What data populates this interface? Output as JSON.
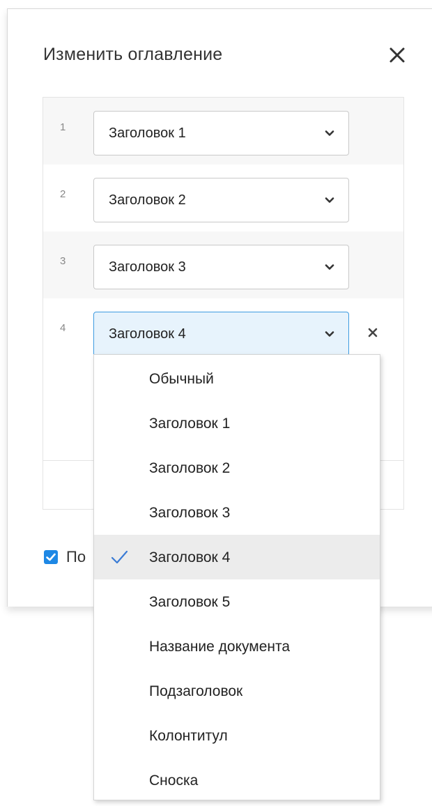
{
  "dialog": {
    "title": "Изменить оглавление",
    "close_icon": "close-icon"
  },
  "levels": [
    {
      "number": "1",
      "style": "Заголовок 1"
    },
    {
      "number": "2",
      "style": "Заголовок 2"
    },
    {
      "number": "3",
      "style": "Заголовок 3"
    },
    {
      "number": "4",
      "style": "Заголовок 4"
    }
  ],
  "checkbox": {
    "checked": true,
    "label_partial": "По"
  },
  "dropdown": {
    "options": [
      "Обычный",
      "Заголовок 1",
      "Заголовок 2",
      "Заголовок 3",
      "Заголовок 4",
      "Заголовок 5",
      "Название документа",
      "Подзаголовок",
      "Колонтитул",
      "Сноска"
    ],
    "selected": "Заголовок 4"
  },
  "colors": {
    "accent": "#1e88e5",
    "active_select_bg": "#e7f3fc",
    "selected_option_bg": "#ececec",
    "tick": "#3a7bd5"
  }
}
